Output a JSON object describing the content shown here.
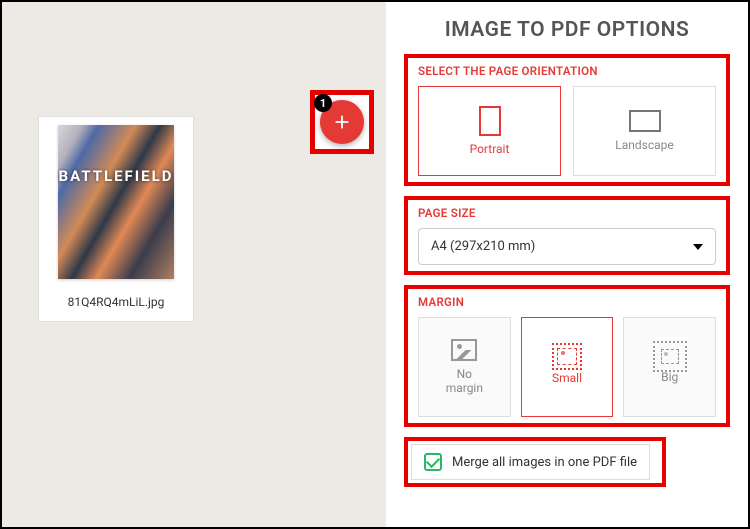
{
  "header": {
    "title": "IMAGE TO PDF OPTIONS"
  },
  "add_button": {
    "badge": "1"
  },
  "thumbnail": {
    "filename": "81Q4RQ4mLiL.jpg",
    "overlay": "BATTLEFIELD"
  },
  "orientation": {
    "label": "SELECT THE PAGE ORIENTATION",
    "options": {
      "portrait": "Portrait",
      "landscape": "Landscape"
    },
    "selected": "portrait"
  },
  "page_size": {
    "label": "PAGE SIZE",
    "value": "A4 (297x210 mm)"
  },
  "margin": {
    "label": "MARGIN",
    "options": {
      "none": "No\nmargin",
      "small": "Small",
      "big": "Big"
    },
    "selected": "small"
  },
  "merge": {
    "label": "Merge all images in one PDF file",
    "checked": true
  }
}
